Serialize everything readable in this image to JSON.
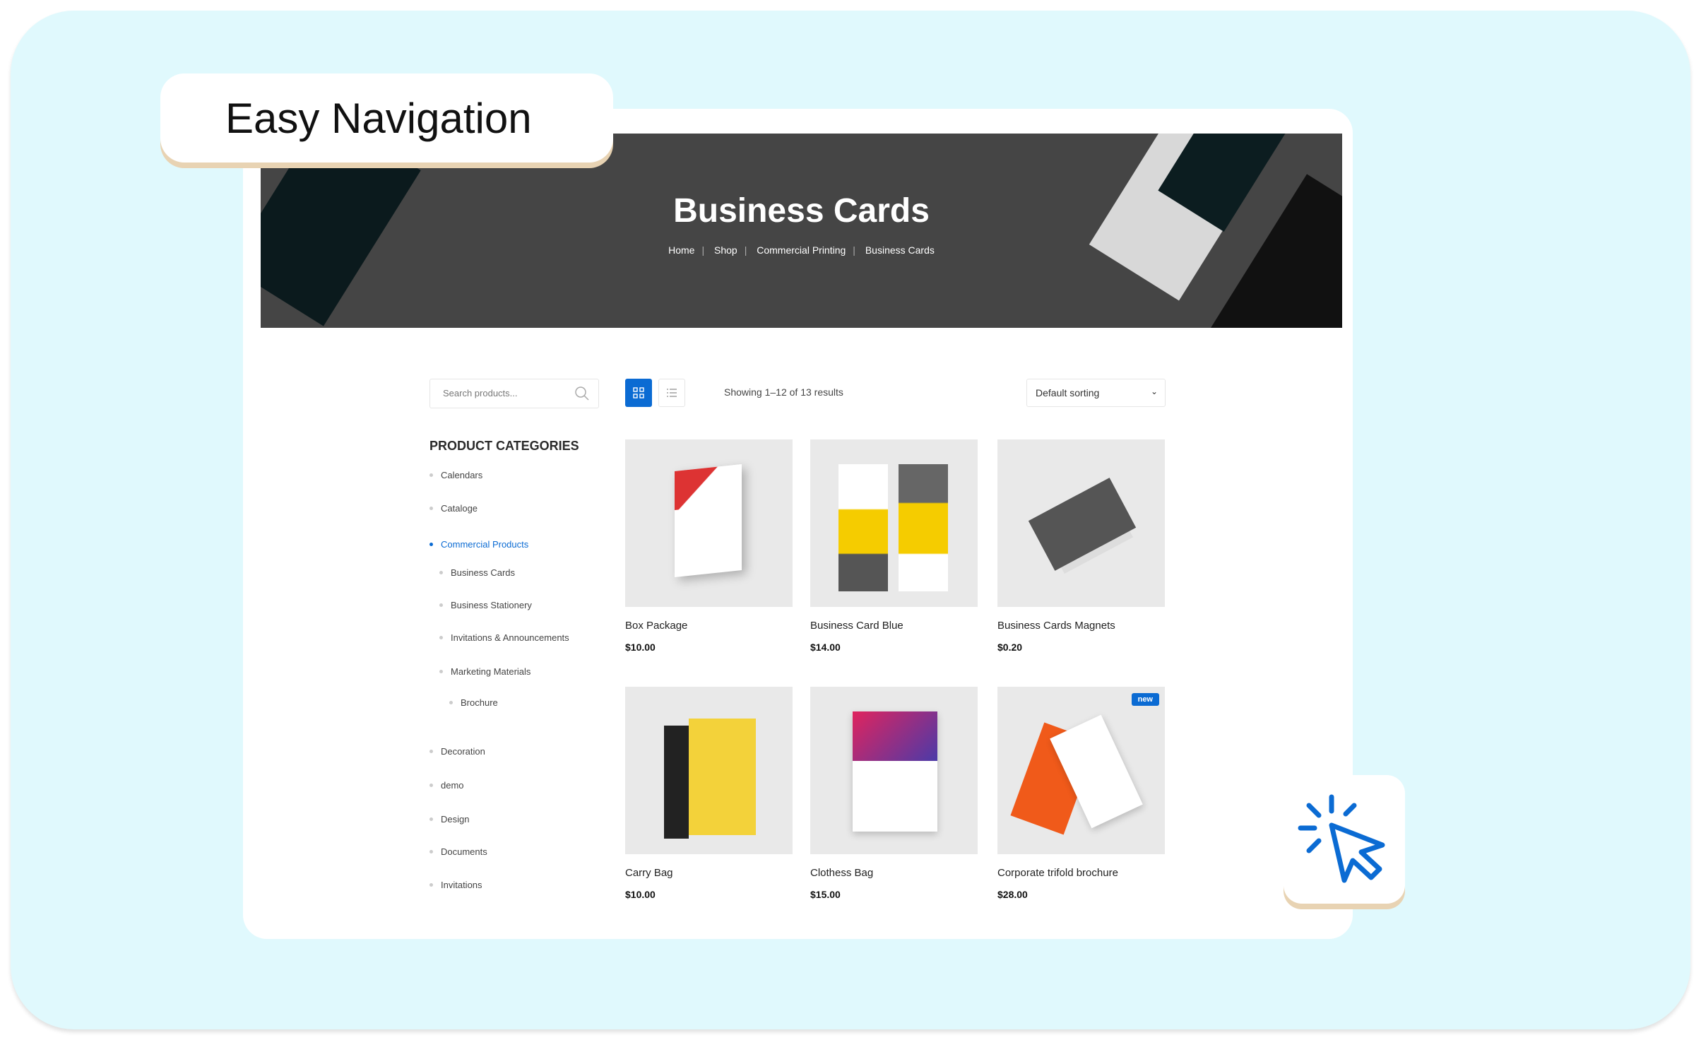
{
  "feature_label": "Easy Navigation",
  "banner": {
    "title": "Business Cards",
    "breadcrumb": [
      "Home",
      "Shop",
      "Commercial Printing",
      "Business Cards"
    ]
  },
  "toolbar": {
    "search_placeholder": "Search products...",
    "showing": "Showing 1–12 of 13 results",
    "sort": "Default sorting",
    "active_view": "grid"
  },
  "sidebar": {
    "heading": "PRODUCT CATEGORIES",
    "items": [
      {
        "label": "Calendars",
        "level": 0
      },
      {
        "label": "Cataloge",
        "level": 0
      },
      {
        "label": "Commercial Products",
        "level": 0,
        "active": true
      },
      {
        "label": "Business Cards",
        "level": 1
      },
      {
        "label": "Business Stationery",
        "level": 1
      },
      {
        "label": "Invitations & Announcements",
        "level": 1
      },
      {
        "label": "Marketing Materials",
        "level": 1
      },
      {
        "label": "Brochure",
        "level": 2
      },
      {
        "label": "Decoration",
        "level": 0
      },
      {
        "label": "demo",
        "level": 0
      },
      {
        "label": "Design",
        "level": 0
      },
      {
        "label": "Documents",
        "level": 0
      },
      {
        "label": "Invitations",
        "level": 0
      }
    ]
  },
  "products": [
    {
      "name": "Box Package",
      "price": "$10.00"
    },
    {
      "name": "Business Card Blue",
      "price": "$14.00"
    },
    {
      "name": "Business Cards Magnets",
      "price": "$0.20"
    },
    {
      "name": "Carry Bag",
      "price": "$10.00"
    },
    {
      "name": "Clothess Bag",
      "price": "$15.00"
    },
    {
      "name": "Corporate trifold brochure",
      "price": "$28.00",
      "badge": "new"
    }
  ],
  "colors": {
    "accent": "#0b6bd3",
    "background": "#e0f9fd",
    "banner": "#454545"
  }
}
